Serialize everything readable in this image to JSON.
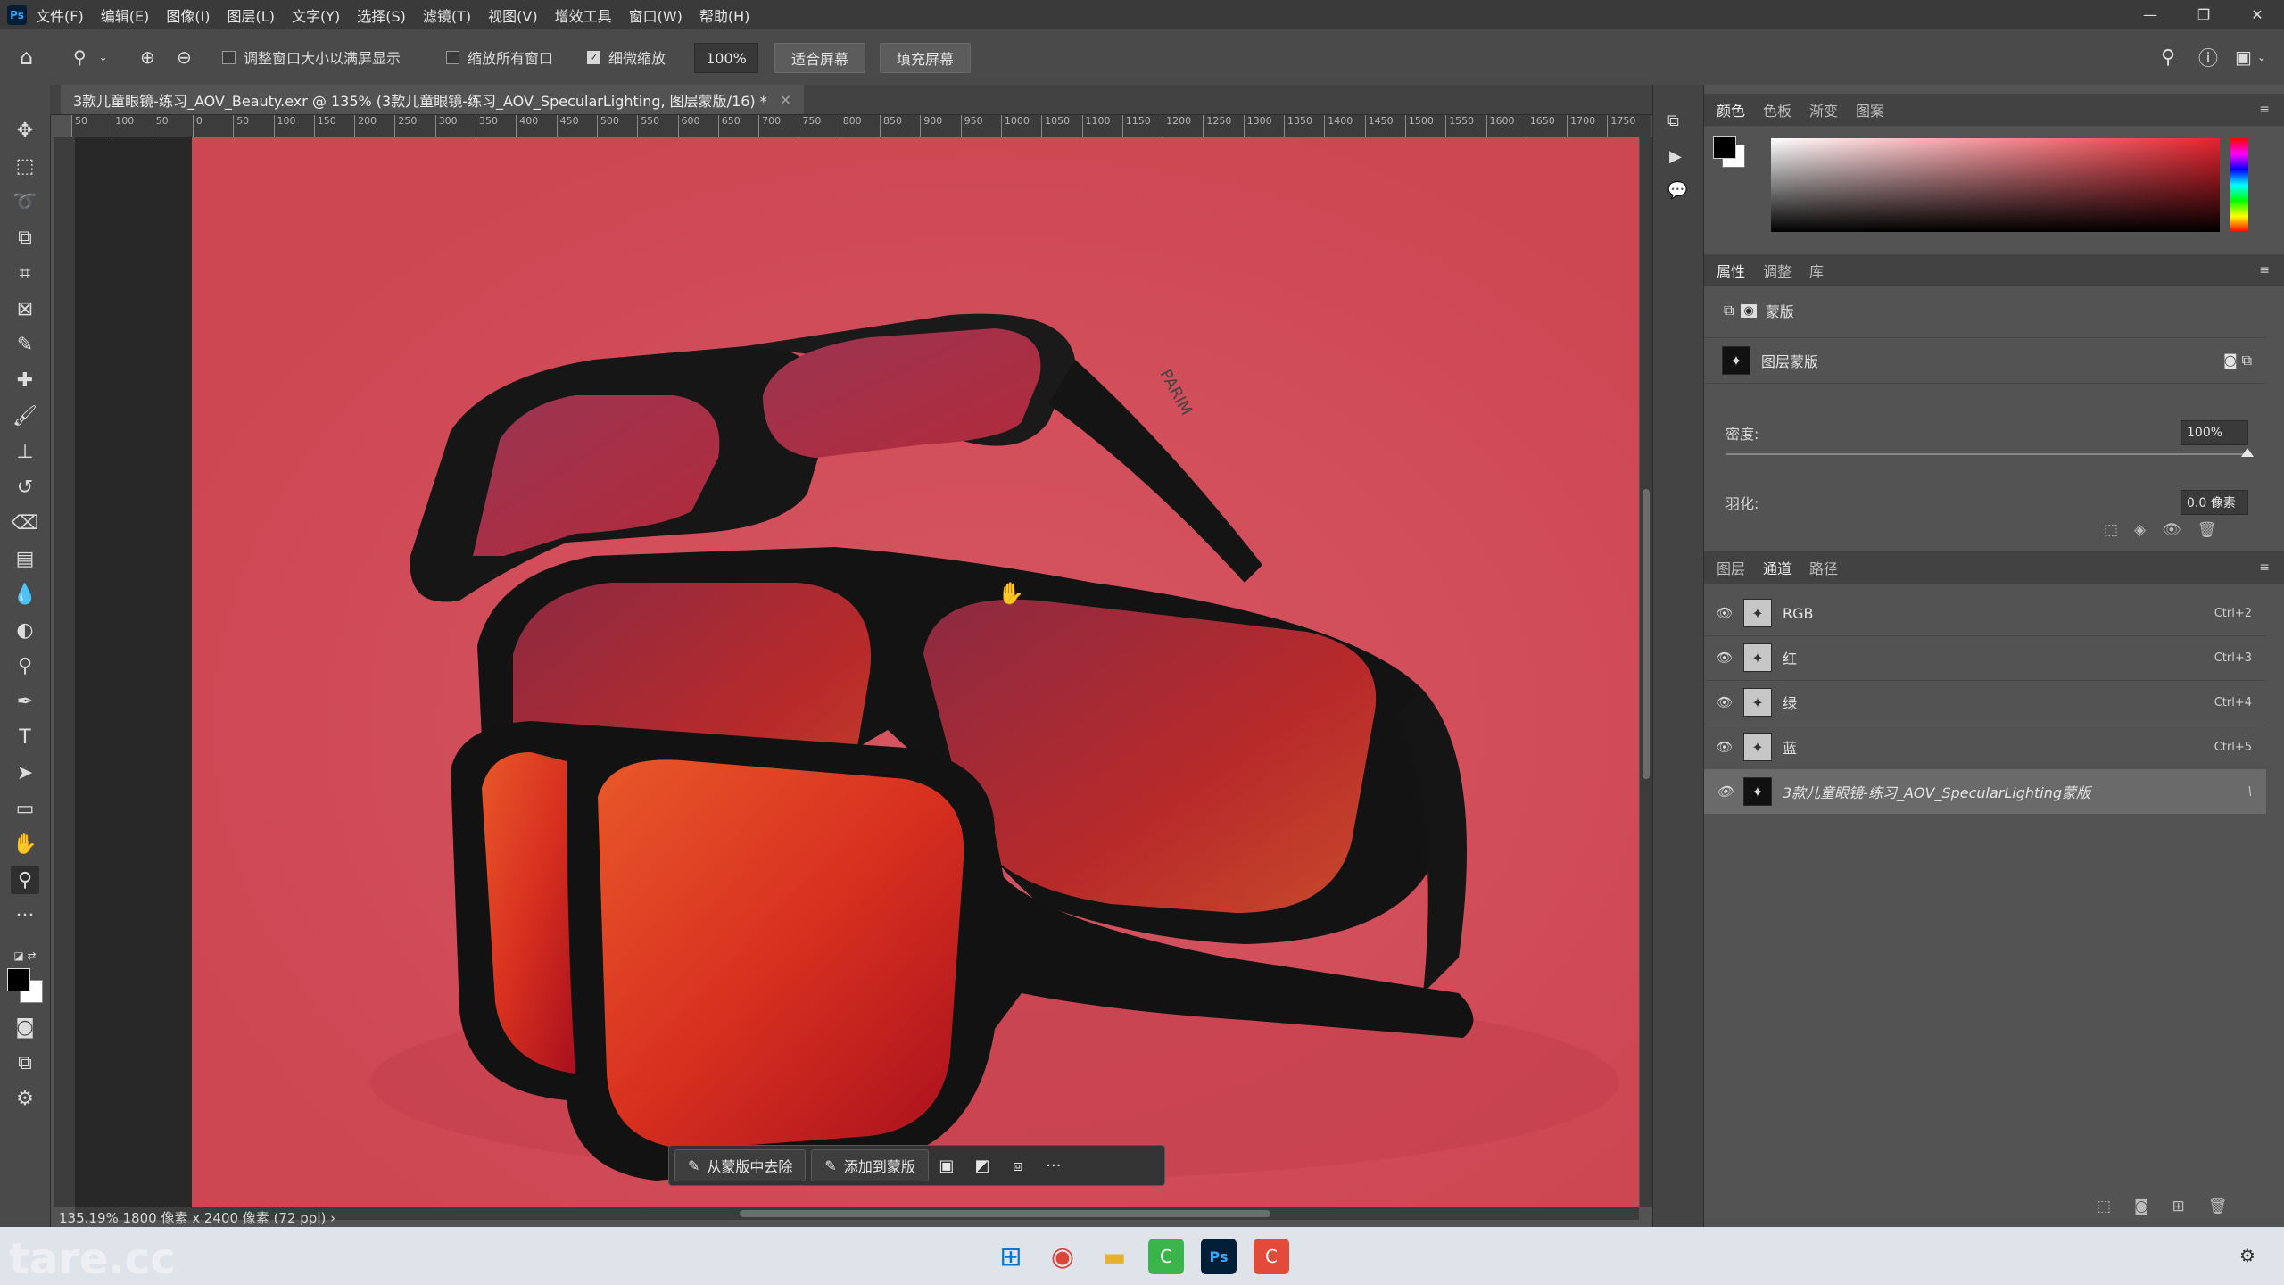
{
  "menu": {
    "items": [
      "文件(F)",
      "编辑(E)",
      "图像(I)",
      "图层(L)",
      "文字(Y)",
      "选择(S)",
      "滤镜(T)",
      "视图(V)",
      "增效工具",
      "窗口(W)",
      "帮助(H)"
    ]
  },
  "window_controls": {
    "minimize": "—",
    "maximize": "❐",
    "close": "✕"
  },
  "options": {
    "resize_windows_label": "调整窗口大小以满屏显示",
    "zoom_all_label": "缩放所有窗口",
    "scrubby_zoom_label": "细微缩放",
    "zoom_value": "100%",
    "fit_screen_label": "适合屏幕",
    "fill_screen_label": "填充屏幕"
  },
  "document": {
    "tab_title": "3款儿童眼镜-练习_AOV_Beauty.exr @ 135% (3款儿童眼镜-练习_AOV_SpecularLighting, 图层蒙版/16) *",
    "tab_close": "×",
    "status": "135.19%  1800 像素 x 2400 像素 (72 ppi)  ›"
  },
  "ruler": {
    "h_labels": [
      "50",
      "100",
      "50",
      "0",
      "50",
      "100",
      "150",
      "200",
      "250",
      "300",
      "350",
      "400",
      "450",
      "500",
      "550",
      "600",
      "650",
      "700",
      "750",
      "800",
      "850",
      "900",
      "950",
      "1000",
      "1050",
      "1100",
      "1150",
      "1200",
      "1250",
      "1300",
      "1350",
      "1400",
      "1450",
      "1500",
      "1550",
      "1600",
      "1650",
      "1700",
      "1750"
    ]
  },
  "context_bar": {
    "subtract_label": "从蒙版中去除",
    "add_label": "添加到蒙版",
    "more": "···"
  },
  "canvas": {
    "frame_text": "PARIM"
  },
  "color_panel": {
    "tabs": [
      "颜色",
      "色板",
      "渐变",
      "图案"
    ],
    "active_tab": 0,
    "foreground": "#000000",
    "background": "#ffffff",
    "hue": "#e8232f"
  },
  "properties_panel": {
    "tabs": [
      "属性",
      "调整",
      "库"
    ],
    "active_tab": 0,
    "mask_type_label": "蒙版",
    "layer_mask_label": "图层蒙版",
    "density_label": "密度:",
    "density_value": "100%",
    "feather_label": "羽化:",
    "feather_value": "0.0 像素"
  },
  "channels_panel": {
    "tabs": [
      "图层",
      "通道",
      "路径"
    ],
    "active_tab": 1,
    "channels": [
      {
        "name": "RGB",
        "shortcut": "Ctrl+2",
        "selected": false
      },
      {
        "name": "红",
        "shortcut": "Ctrl+3",
        "selected": false
      },
      {
        "name": "绿",
        "shortcut": "Ctrl+4",
        "selected": false
      },
      {
        "name": "蓝",
        "shortcut": "Ctrl+5",
        "selected": false
      },
      {
        "name": "3款儿童眼镜-练习_AOV_SpecularLighting蒙版",
        "shortcut": "\\",
        "selected": true
      }
    ]
  },
  "taskbar": {
    "apps": [
      "windows-start",
      "chrome",
      "file-explorer",
      "camtasia",
      "photoshop",
      "recorder"
    ],
    "watermark": "tare.cc"
  }
}
